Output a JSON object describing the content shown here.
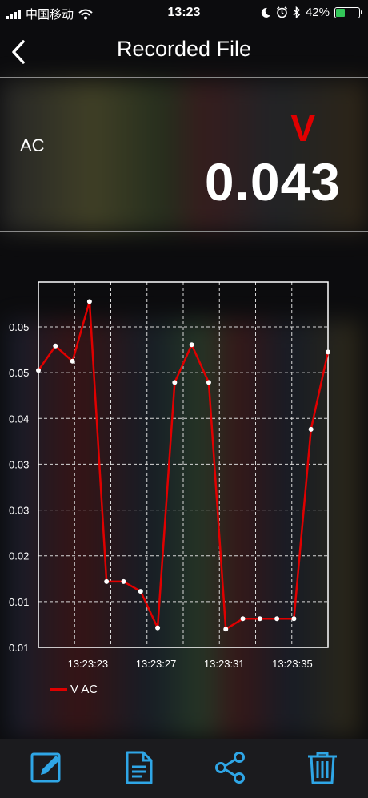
{
  "status_bar": {
    "carrier": "中国移动",
    "time": "13:23",
    "battery_percent_text": "42%",
    "battery_level": 0.42,
    "icons": [
      "signal-icon",
      "wifi-icon",
      "moon-icon",
      "alarm-icon",
      "bluetooth-icon",
      "battery-icon"
    ]
  },
  "nav": {
    "title": "Recorded File",
    "back_icon": "chevron-left-icon"
  },
  "reading": {
    "mode": "AC",
    "unit": "V",
    "value": "0.043",
    "unit_color": "#e00000"
  },
  "chart_data": {
    "type": "line",
    "x_tick_labels": [
      "13:23:23",
      "13:23:27",
      "13:23:31",
      "13:23:35"
    ],
    "y_tick_labels": [
      "0.05",
      "0.05",
      "0.04",
      "0.03",
      "0.03",
      "0.02",
      "0.01",
      "0.01"
    ],
    "grid": true,
    "legend_position": "bottom-left",
    "series": [
      {
        "name": "V AC",
        "color": "#e00000",
        "values": [
          0.0455,
          0.0495,
          0.047,
          0.0568,
          0.0108,
          0.0108,
          0.0092,
          0.0032,
          0.0435,
          0.0497,
          0.0435,
          0.003,
          0.0047,
          0.0047,
          0.0047,
          0.0047,
          0.0358,
          0.0485
        ]
      }
    ],
    "x_start_index": 0,
    "x_tick_indices": [
      3,
      7,
      11,
      15
    ],
    "ylim": [
      0,
      0.06
    ]
  },
  "legend": {
    "label": "V AC"
  },
  "toolbar": {
    "accent": "#2fa6e6",
    "items": [
      {
        "name": "edit-button",
        "icon": "pencil-icon"
      },
      {
        "name": "document-button",
        "icon": "document-icon"
      },
      {
        "name": "share-button",
        "icon": "share-icon"
      },
      {
        "name": "delete-button",
        "icon": "trash-icon"
      }
    ]
  }
}
